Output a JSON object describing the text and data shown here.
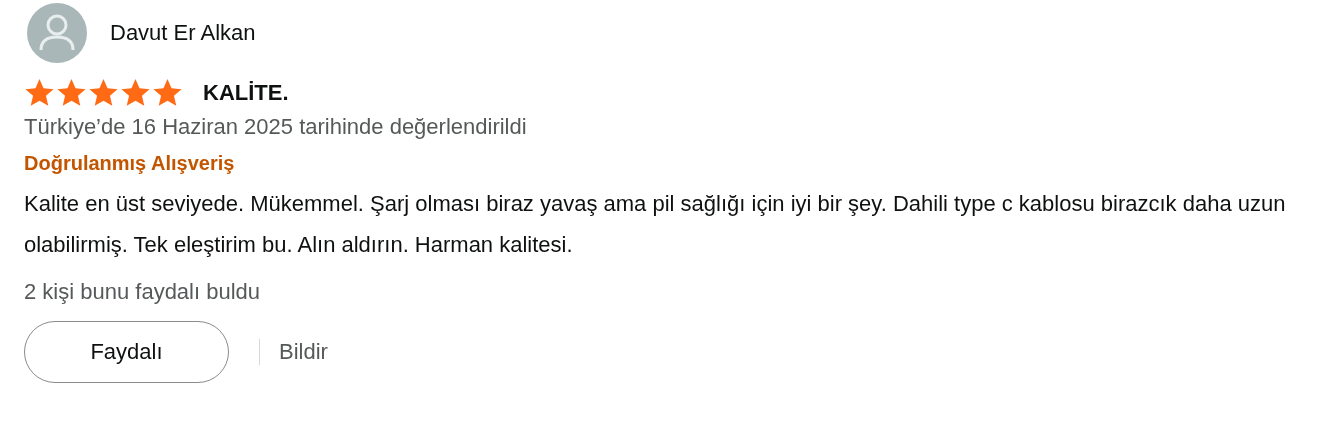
{
  "reviewer": {
    "name": "Davut Er Alkan"
  },
  "review": {
    "stars": 5,
    "title": "KALİTE.",
    "date": "Türkiye’de 16 Haziran 2025 tarihinde değerlendirildi",
    "badge": "Doğrulanmış Alışveriş",
    "body": "Kalite en üst seviyede. Mükemmel. Şarj olması biraz yavaş ama pil sağlığı için iyi bir şey. Dahili type c kablosu birazcık daha uzun olabilirmiş. Tek eleştirim bu. Alın aldırın. Harman kalitesi.",
    "helpful_count": "2 kişi bunu faydalı buldu"
  },
  "actions": [
    {
      "kind": "button",
      "label": "Faydalı"
    },
    {
      "kind": "link",
      "label": "Bildir"
    }
  ]
}
